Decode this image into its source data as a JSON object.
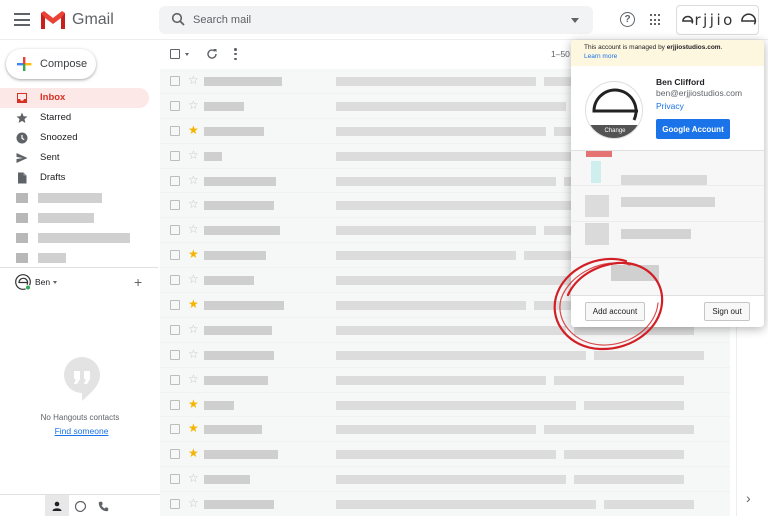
{
  "header": {
    "app_name": "Gmail",
    "search_placeholder": "Search mail",
    "brand_text": "rjjio"
  },
  "sidebar": {
    "compose_label": "Compose",
    "items": [
      {
        "label": "Inbox",
        "icon": "inbox-icon",
        "active": true
      },
      {
        "label": "Starred",
        "icon": "star-icon"
      },
      {
        "label": "Snoozed",
        "icon": "clock-icon"
      },
      {
        "label": "Sent",
        "icon": "send-icon"
      },
      {
        "label": "Drafts",
        "icon": "drafts-icon"
      }
    ],
    "hangouts": {
      "user": "Ben",
      "empty_text": "No Hangouts contacts",
      "find_link": "Find someone"
    }
  },
  "mail": {
    "page_range": "1–50",
    "starred_rows": [
      2,
      7,
      9,
      13,
      14,
      15
    ]
  },
  "account_popup": {
    "managed_prefix": "This account is managed by ",
    "managed_domain": "erjjiostudios.com",
    "managed_suffix": ".",
    "learn_more": "Learn more",
    "name": "Ben Clifford",
    "email": "ben@erjjiostudios.com",
    "privacy": "Privacy",
    "change_label": "Change",
    "google_account_button": "Google Account",
    "add_account_button": "Add account",
    "sign_out_button": "Sign out"
  },
  "colors": {
    "accent_red": "#d93025",
    "link_blue": "#1a73e8",
    "star_yellow": "#f4b400",
    "annotation_red": "#d21f26"
  }
}
